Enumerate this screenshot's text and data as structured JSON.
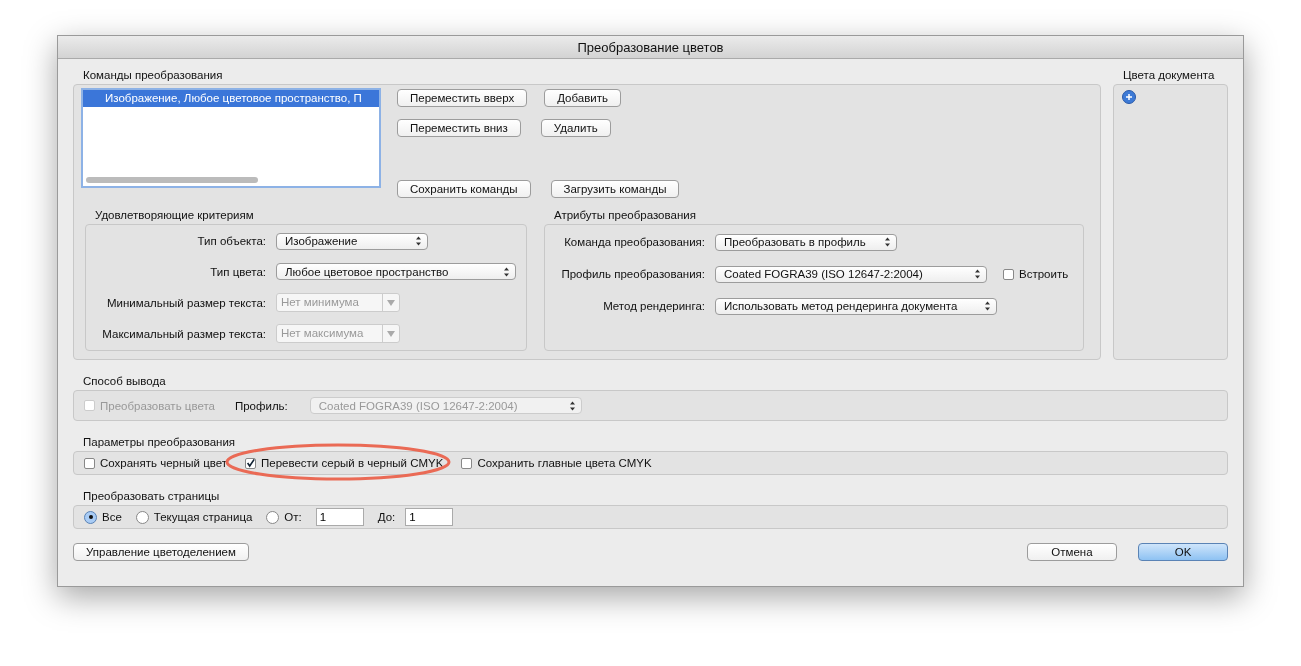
{
  "window": {
    "title": "Преобразование цветов"
  },
  "commands": {
    "label": "Команды преобразования",
    "items": [
      {
        "text": "Изображение, Любое цветовое пространство, П",
        "selected": true
      }
    ],
    "buttons": [
      {
        "label": "Переместить вверх"
      },
      {
        "label": "Добавить"
      },
      {
        "label": "Переместить вниз"
      },
      {
        "label": "Удалить"
      },
      {
        "label": "Сохранить команды"
      },
      {
        "label": "Загрузить команды"
      }
    ]
  },
  "criteria": {
    "label": "Удовлетворяющие критериям",
    "rows": [
      {
        "label": "Тип объекта:",
        "kind": "select",
        "value": "Изображение",
        "disabled": false
      },
      {
        "label": "Тип цвета:",
        "kind": "select",
        "value": "Любое цветовое пространство",
        "disabled": false
      },
      {
        "label": "Минимальный размер текста:",
        "kind": "combo",
        "value": "Нет минимума",
        "disabled": true
      },
      {
        "label": "Максимальный размер текста:",
        "kind": "combo",
        "value": "Нет максимума",
        "disabled": true
      }
    ]
  },
  "attributes": {
    "label": "Атрибуты преобразования",
    "rows": [
      {
        "label": "Команда преобразования:",
        "kind": "select",
        "value": "Преобразовать в профиль",
        "disabled": false
      },
      {
        "label": "Профиль преобразования:",
        "kind": "select",
        "value": "Coated FOGRA39 (ISO 12647-2:2004)",
        "disabled": false
      },
      {
        "label": "Метод рендеринга:",
        "kind": "select",
        "value": "Использовать метод рендеринга документа",
        "disabled": false
      }
    ],
    "embed": {
      "label": "Встроить",
      "checked": false
    }
  },
  "document_colors": {
    "label": "Цвета документа"
  },
  "output": {
    "label": "Способ вывода",
    "convert": {
      "label": "Преобразовать цвета",
      "checked": false,
      "disabled": true
    },
    "profile_label": "Профиль:",
    "profile": {
      "value": "Coated FOGRA39 (ISO 12647-2:2004)",
      "disabled": true
    }
  },
  "options": {
    "label": "Параметры преобразования",
    "items": [
      {
        "label": "Сохранять черный цвет",
        "checked": false
      },
      {
        "label": "Перевести серый в черный CMYK",
        "checked": true
      },
      {
        "label": "Сохранить главные цвета CMYK",
        "checked": false
      }
    ]
  },
  "pages": {
    "label": "Преобразовать страницы",
    "options": [
      {
        "label": "Все",
        "selected": true
      },
      {
        "label": "Текущая страница",
        "selected": false
      },
      {
        "label": "От:",
        "selected": false
      }
    ],
    "from": "1",
    "to_label": "До:",
    "to": "1"
  },
  "footer": {
    "separation_button": "Управление цветоделением",
    "cancel": "Отмена",
    "ok": "OK"
  }
}
